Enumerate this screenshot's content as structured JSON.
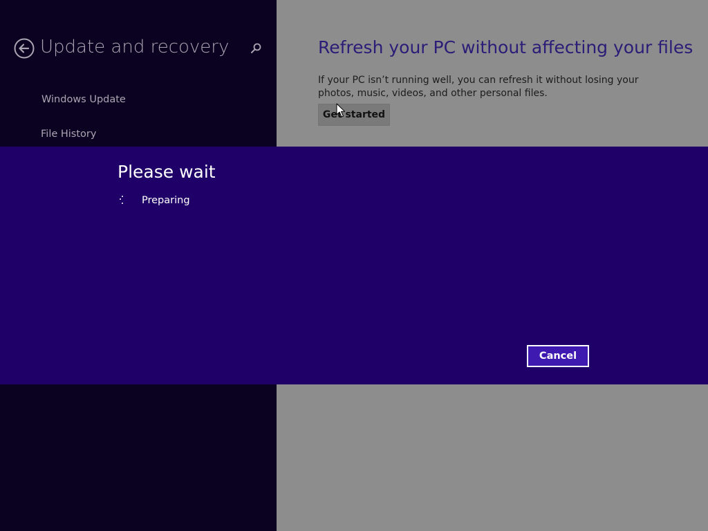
{
  "nav": {
    "title": "Update and recovery",
    "back_icon": "back-arrow-icon",
    "search_icon": "search-icon",
    "items": [
      {
        "label": "Windows Update"
      },
      {
        "label": "File History"
      }
    ]
  },
  "content": {
    "heading": "Refresh your PC without affecting your files",
    "description": "If your PC isn’t running well, you can refresh it without losing your photos, music, videos, and other personal files.",
    "get_started_label": "Get started"
  },
  "dialog": {
    "title": "Please wait",
    "status": "Preparing",
    "spinner_icon": "progress-dots-icon",
    "cancel_label": "Cancel"
  },
  "colors": {
    "nav_background": "#0b0120",
    "content_background": "#8d8d8d",
    "dialog_background": "#1f0068",
    "heading_accent": "#2c1c77",
    "cancel_button": "#3f1ab0"
  }
}
